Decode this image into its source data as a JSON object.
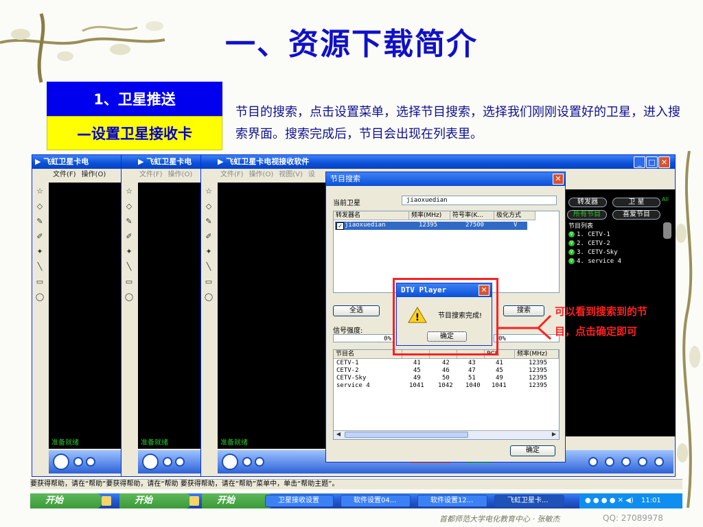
{
  "slide": {
    "title": "一、资源下载简介",
    "box_blue": "1、卫星推送",
    "box_yellow": "—设置卫星接收卡",
    "description": "节目的搜索，点击设置菜单，选择节目搜索，选择我们刚刚设置好的卫星，进入搜索界面。搜索完成后，节目会出现在列表里。",
    "annotation_line1": "可以看到搜索到的节",
    "annotation_line2": "目，点击确定即可",
    "footer": "首都师范大学电化教育中心 · 张敏杰",
    "qq": "QQ: 27089978"
  },
  "windows": [
    {
      "title": "飞虹卫星卡电",
      "menus": [
        "文件(F)",
        "操作(O)"
      ],
      "status": "准备就绪"
    },
    {
      "title": "飞虹卫星卡电",
      "menus": [
        "文件(F)",
        "操作(O)"
      ],
      "status": "准备就绪"
    },
    {
      "title": "飞虹卫星卡电视接收软件",
      "menus": [
        "文件(F)",
        "操作(O)",
        "视图(V)",
        "设"
      ],
      "status": "准备就绪"
    }
  ],
  "dialog": {
    "title": "节目搜索",
    "current_sat_label": "当前卫星",
    "current_sat_value": "jiaoxuedian",
    "transponder_headers": [
      "转发器名",
      "频率(MHz)",
      "符号率(K...",
      "极化方式"
    ],
    "transponder_row": {
      "name": "jiaoxuedian",
      "freq": "12395",
      "symrate": "27500",
      "pol": "V",
      "checked": true
    },
    "select_all": "全选",
    "search": "搜索",
    "signal_label": "信号强度:",
    "signal_pct_left": "0%",
    "signal_pct_right": "0%",
    "program_headers": [
      "节目名",
      "",
      "",
      "",
      "PCR",
      "频率(MHz)"
    ],
    "program_rows": [
      {
        "name": "CETV-1",
        "a": "41",
        "b": "42",
        "c": "43",
        "pcr": "41",
        "freq": "12395"
      },
      {
        "name": "CETV-2",
        "a": "45",
        "b": "46",
        "c": "47",
        "pcr": "45",
        "freq": "12395"
      },
      {
        "name": "CETV-Sky",
        "a": "49",
        "b": "50",
        "c": "51",
        "pcr": "49",
        "freq": "12395"
      },
      {
        "name": "service 4",
        "a": "1041",
        "b": "1042",
        "c": "1040",
        "pcr": "1041",
        "freq": "12395"
      }
    ],
    "ok": "确定"
  },
  "msgbox": {
    "title": "DTV Player",
    "message": "节目搜索完成!",
    "ok": "确定"
  },
  "right_panel": {
    "btn_transponder": "转发器",
    "btn_satellite": "卫 星",
    "btn_all": "All",
    "btn_all_programs": "所有节目",
    "btn_favorites": "喜爱节目",
    "list_title": "节目列表",
    "channels": [
      "1. CETV-1",
      "2. CETV-2",
      "3. CETV-Sky",
      "4. service 4"
    ]
  },
  "helpbar": {
    "text": "要获得帮助，请在“帮助”要获得帮助，请在“帮助 要获得帮助，请在“帮助”菜单中，单击“帮助主题”。"
  },
  "taskbar": {
    "start1": "开始",
    "start2": "开始",
    "start3": "开始",
    "items": [
      "卫星接收设置",
      "软件设置04...",
      "软件设置12...",
      "飞虹卫星卡..."
    ],
    "clock": "11:01"
  },
  "colors": {
    "title": "#1010c8",
    "box_blue": "#0000ee",
    "box_yellow": "#ffff00",
    "annotation": "#ff2020",
    "xp_blue": "#0a4fd6"
  }
}
